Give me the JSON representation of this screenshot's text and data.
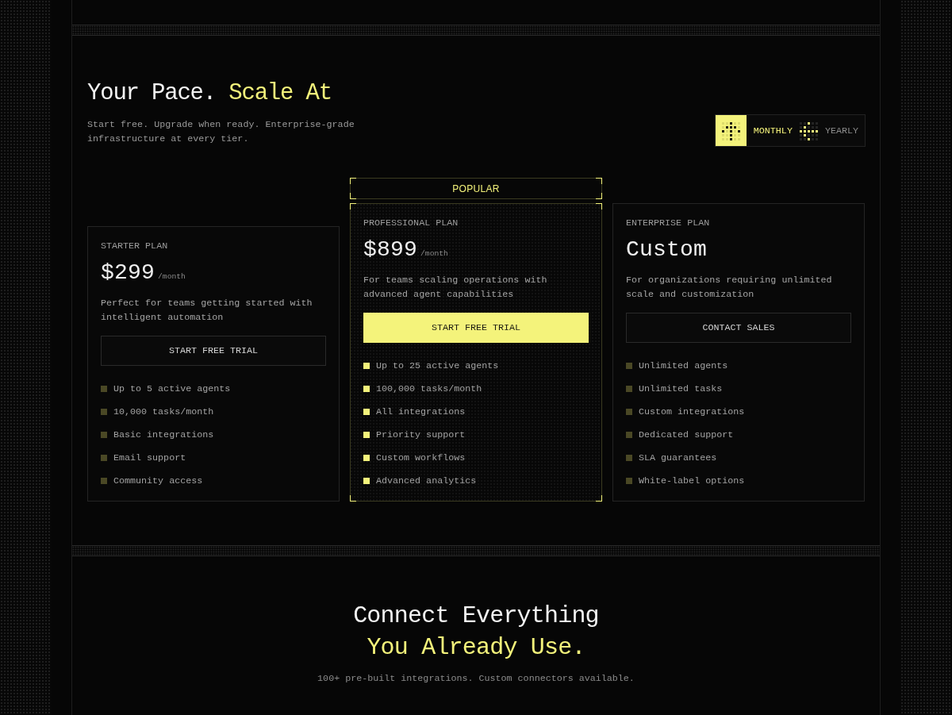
{
  "pricing": {
    "title": "Your Pace.",
    "title_highlight": "Scale At",
    "subtitle": "Start free. Upgrade when ready. Enterprise-grade infrastructure at every tier.",
    "billing_toggle": [
      {
        "label": "MONTHLY",
        "selected": true
      },
      {
        "label": "YEARLY",
        "selected": false
      }
    ],
    "plans": [
      {
        "name": "STARTER PLAN",
        "price": "$299",
        "period": "/month",
        "description": "Perfect for teams getting started with intelligent automation",
        "button": "START FREE TRIAL",
        "featured": false,
        "features": [
          "Up to 5 active agents",
          "10,000 tasks/month",
          "Basic integrations",
          "Email support",
          "Community access"
        ]
      },
      {
        "badge": "POPULAR",
        "name": "PROFESSIONAL PLAN",
        "price": "$899",
        "period": "/month",
        "description": "For teams scaling operations with advanced agent capabilities",
        "button": "START FREE TRIAL",
        "featured": true,
        "features": [
          "Up to 25 active agents",
          "100,000 tasks/month",
          "All integrations",
          "Priority support",
          "Custom workflows",
          "Advanced analytics"
        ]
      },
      {
        "name": "ENTERPRISE PLAN",
        "price": "Custom",
        "description": "For organizations requiring unlimited scale and customization",
        "button": "CONTACT SALES",
        "featured": false,
        "features": [
          "Unlimited agents",
          "Unlimited tasks",
          "Custom integrations",
          "Dedicated support",
          "SLA guarantees",
          "White-label options"
        ]
      }
    ]
  },
  "integrations": {
    "title": "Connect Everything",
    "title_highlight": "You Already Use.",
    "subtitle": "100+ pre-built integrations. Custom connectors available."
  }
}
